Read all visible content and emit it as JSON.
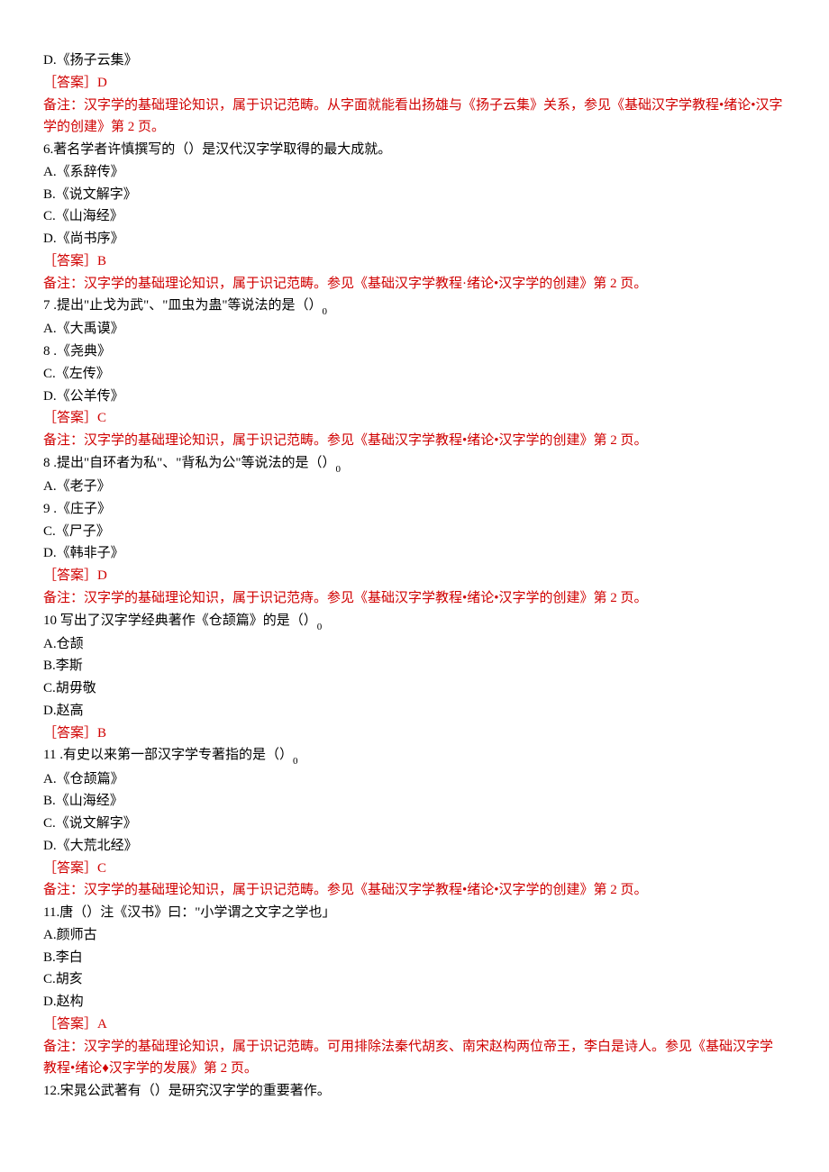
{
  "q5": {
    "optD": "D.《扬子云集》",
    "answer": "［答案］D",
    "note": "备注：汉字学的基础理论知识，属于识记范畴。从字面就能看出扬雄与《扬子云集》关系，参见《基础汉字学教程•绪论•汉字学的创建》第 2 页。"
  },
  "q6": {
    "stem": "6.著名学者许慎撰写的（）是汉代汉字学取得的最大成就。",
    "optA": "A.《系辞传》",
    "optB": "B.《说文解字》",
    "optC": "C.《山海经》",
    "optD": "D.《尚书序》",
    "answer": "［答案］B",
    "note": "备注：汉字学的基础理论知识，属于识记范畴。参见《基础汉字学教程·绪论•汉字学的创建》第 2 页。"
  },
  "q7": {
    "stem_a": "7 .提出\"止戈为武\"、\"皿虫为蛊\"等说法的是（）",
    "stem_b": "0",
    "optA": "A.《大禹谟》",
    "optB": "8 .《尧典》",
    "optC": "C.《左传》",
    "optD": "D.《公羊传》",
    "answer": "［答案］C",
    "note": "备注：汉字学的基础理论知识，属于识记范畴。参见《基础汉字学教程•绪论•汉字学的创建》第 2 页。"
  },
  "q8": {
    "stem_a": "8 .提出\"自环者为私\"、\"背私为公\"等说法的是（）",
    "stem_b": "0",
    "optA": "A.《老子》",
    "optB": "9 .《庄子》",
    "optC": "C.《尸子》",
    "optD": "D.《韩非子》",
    "answer": "［答案］D",
    "note": "备注：汉字学的基础理论知识，属于识记范痔。参见《基础汉字学教程•绪论•汉字学的创建》第 2 页。"
  },
  "q10": {
    "stem_a": "10 写出了汉字学经典著作《仓颉篇》的是（）",
    "stem_b": "0",
    "optA": "A.仓颉",
    "optB": "B.李斯",
    "optC": "C.胡毋敬",
    "optD": "D.赵高",
    "answer": "［答案］B"
  },
  "q11a": {
    "stem_a": "11 .有史以来第一部汉字学专著指的是（）",
    "stem_b": "0",
    "optA": "A.《仓颉篇》",
    "optB": "B.《山海经》",
    "optC": "C.《说文解字》",
    "optD": "D.《大荒北经》",
    "answer": "［答案］C",
    "note": "备注：汉字学的基础理论知识，属于识记范畴。参见《基础汉字学教程•绪论•汉字学的创建》第 2 页。"
  },
  "q11b": {
    "stem": "11.唐（）注《汉书》曰：\"小学谓之文字之学也」",
    "optA": "A.颜师古",
    "optB": "B.李白",
    "optC": "C.胡亥",
    "optD": "D.赵构",
    "answer": "［答案］A",
    "note": "备注：汉字学的基础理论知识，属于识记范畴。可用排除法秦代胡亥、南宋赵构两位帝王，李白是诗人。参见《基础汉字学教程•绪论♦汉字学的发展》第 2 页。"
  },
  "q12": {
    "stem": "12.宋晁公武著有（）是研究汉字学的重要著作。"
  }
}
